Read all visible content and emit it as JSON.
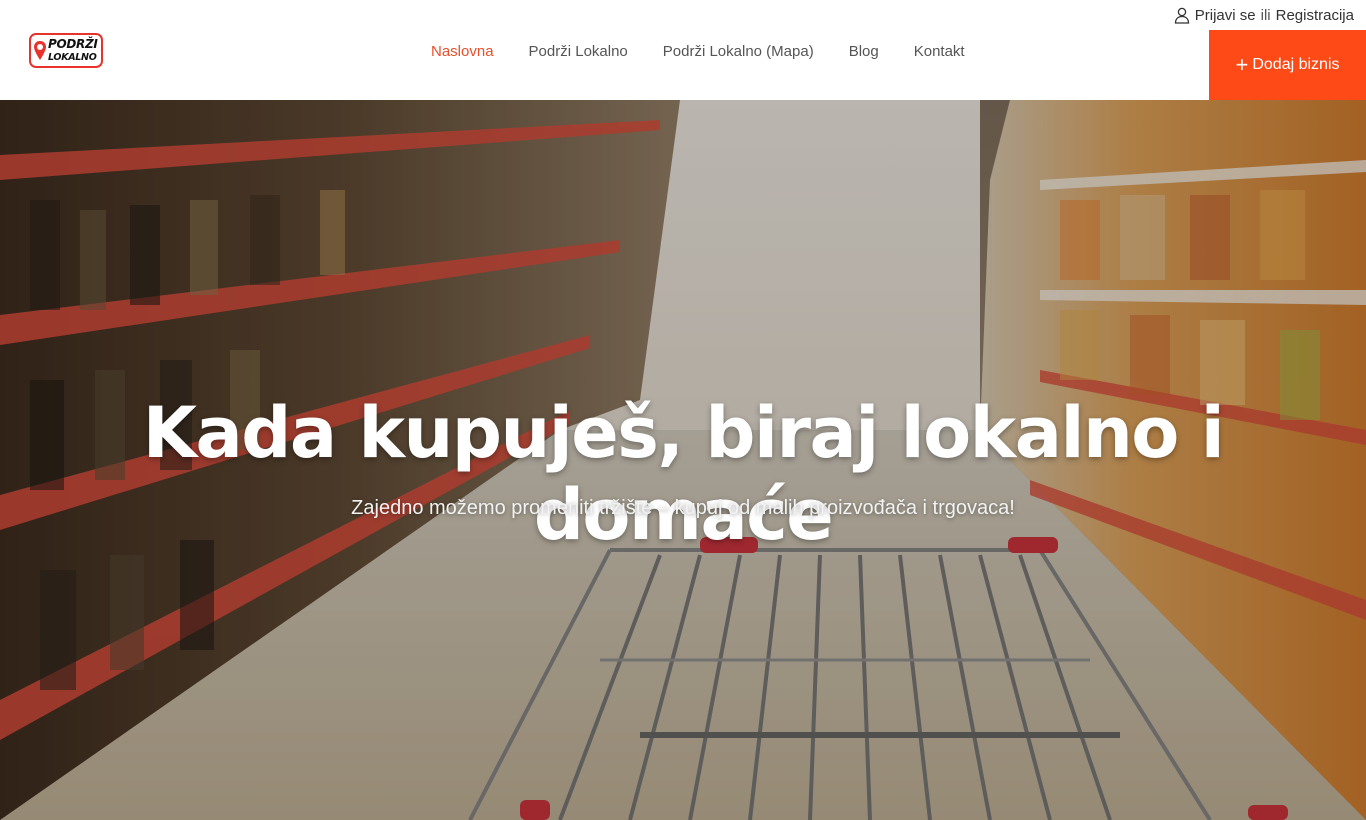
{
  "header": {
    "logo": {
      "line1": "PODRŽI",
      "line2": "LOKALNO"
    },
    "nav": [
      {
        "label": "Naslovna",
        "active": true
      },
      {
        "label": "Podrži Lokalno",
        "active": false
      },
      {
        "label": "Podrži Lokalno (Mapa)",
        "active": false
      },
      {
        "label": "Blog",
        "active": false
      },
      {
        "label": "Kontakt",
        "active": false
      }
    ],
    "auth": {
      "login": "Prijavi se",
      "separator": "ili",
      "register": "Registracija"
    },
    "add_business": {
      "icon": "plus-icon",
      "label": "Dodaj biznis"
    }
  },
  "hero": {
    "title": "Kada kupuješ, biraj lokalno i domaće",
    "subtitle": "Zajedno možemo promeniti tržište – kupuj od malih proizvođača i trgovaca!",
    "background": "supermarket-aisle-with-shopping-cart"
  },
  "colors": {
    "accent": "#fe4a17",
    "nav_active": "#e8502b",
    "logo_red": "#e8322b",
    "nav_text": "#555555"
  }
}
